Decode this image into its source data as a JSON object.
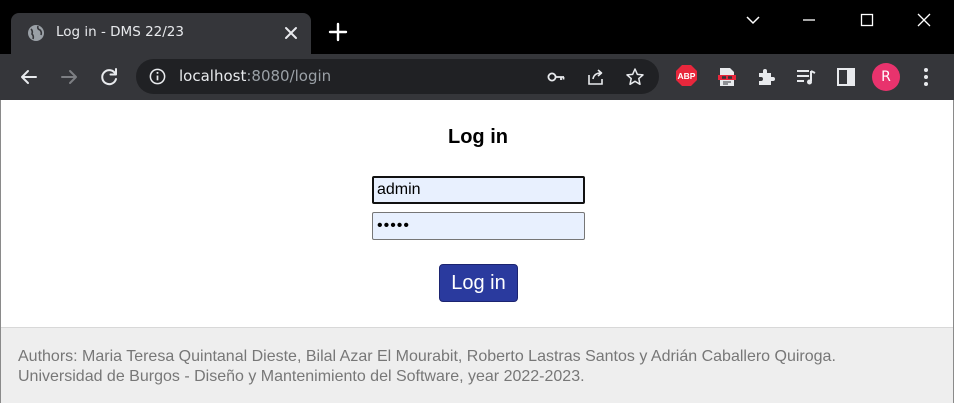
{
  "browser": {
    "tab": {
      "title": "Log in - DMS 22/23"
    },
    "address": {
      "host": "localhost",
      "rest": ":8080/login"
    },
    "abp_label": "ABP",
    "profile_initial": "R"
  },
  "page": {
    "heading": "Log in",
    "username_value": "admin",
    "password_value": "•••••",
    "login_label": "Log in",
    "footer": {
      "authors": "Authors: Maria Teresa Quintanal Dieste, Bilal Azar El Mourabit, Roberto Lastras Santos y Adrián Caballero Quiroga.",
      "university": "Universidad de Burgos - Diseño y Mantenimiento del Software, year 2022-2023."
    }
  },
  "colors": {
    "titlebar": "#000000",
    "toolbar": "#35363a",
    "button_accent": "#2a3a9e",
    "autofill_bg": "#e8f0fe",
    "profile_avatar": "#e8336d",
    "abp_red": "#e8273c",
    "footer_bg": "#eeeeee"
  }
}
